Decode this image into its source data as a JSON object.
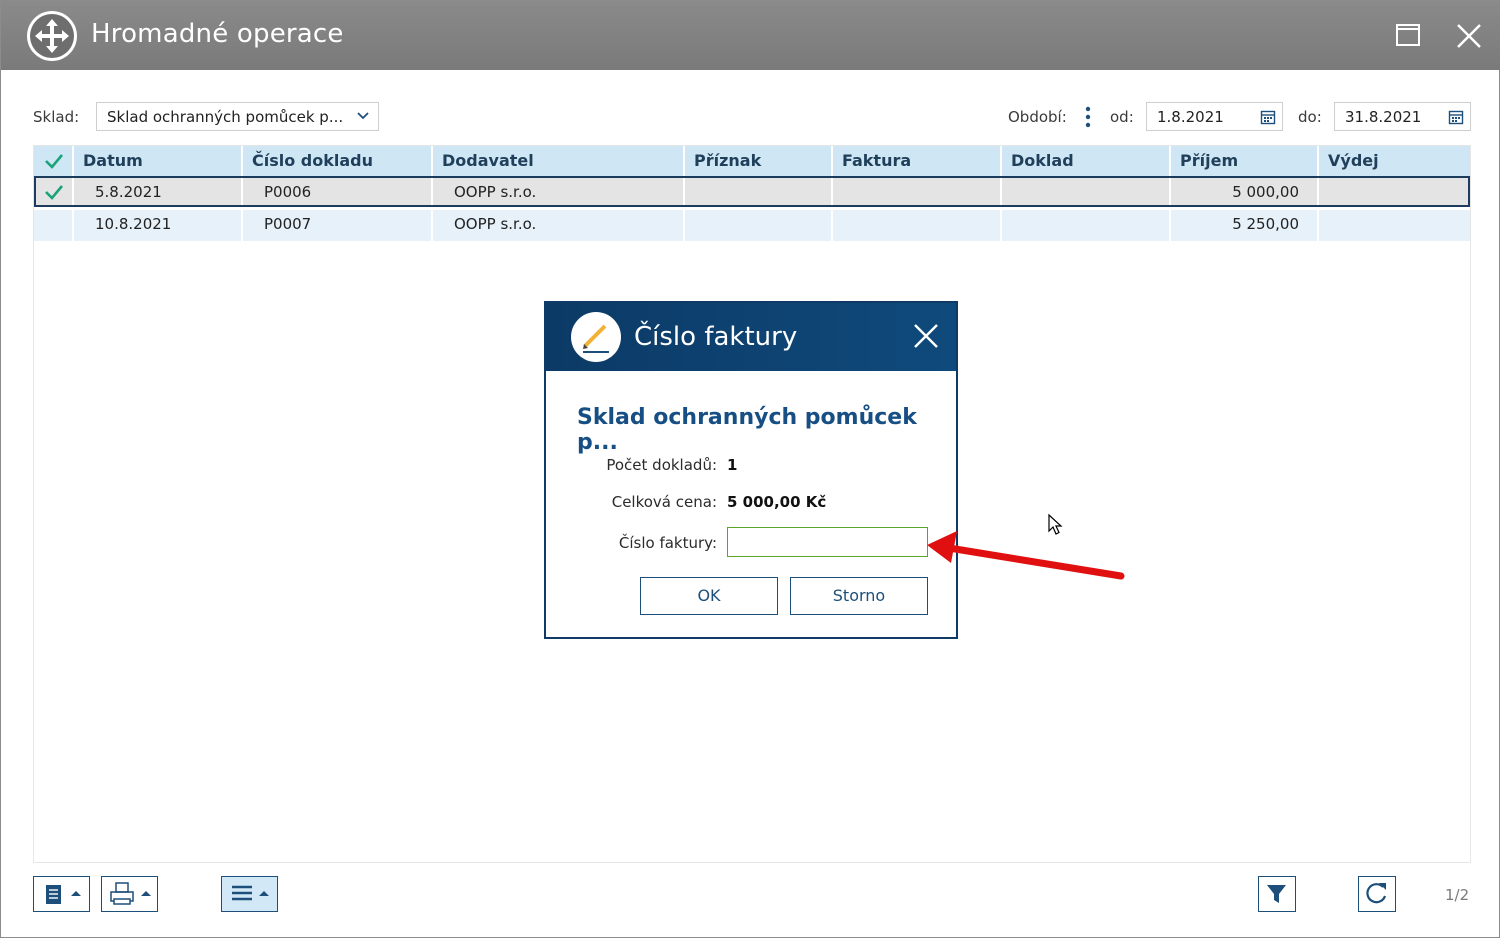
{
  "window": {
    "title": "Hromadné operace"
  },
  "filter": {
    "sklad_label": "Sklad:",
    "sklad_value": "Sklad ochranných pomůcek p...",
    "obdobi_label": "Období:",
    "od_label": "od:",
    "od_value": "1.8.2021",
    "do_label": "do:",
    "do_value": "31.8.2021"
  },
  "grid": {
    "columns": [
      "Datum",
      "Číslo dokladu",
      "Dodavatel",
      "Příznak",
      "Faktura",
      "Doklad",
      "Příjem",
      "Výdej"
    ],
    "rows": [
      {
        "datum": "5.8.2021",
        "cislo": "P0006",
        "dodavatel": "OOPP s.r.o.",
        "priznak": "",
        "faktura": "",
        "doklad": "",
        "prijem": "5 000,00",
        "vydej": ""
      },
      {
        "datum": "10.8.2021",
        "cislo": "P0007",
        "dodavatel": "OOPP s.r.o.",
        "priznak": "",
        "faktura": "",
        "doklad": "",
        "prijem": "5 250,00",
        "vydej": ""
      }
    ]
  },
  "footer": {
    "pager": "1/2"
  },
  "dialog": {
    "title": "Číslo faktury",
    "heading": "Sklad ochranných pomůcek p...",
    "pocet_label": "Počet dokladů:",
    "pocet_value": "1",
    "cena_label": "Celková cena:",
    "cena_value": "5 000,00 Kč",
    "faktura_label": "Číslo faktury:",
    "faktura_value": "",
    "ok_label": "OK",
    "storno_label": "Storno"
  },
  "colors": {
    "titlebar": "#808080",
    "dialog_header": "#0c3a66",
    "grid_header": "#cfe6f5",
    "check": "#1aa37a",
    "input_border": "#5aa52a",
    "arrow": "#e01010"
  }
}
